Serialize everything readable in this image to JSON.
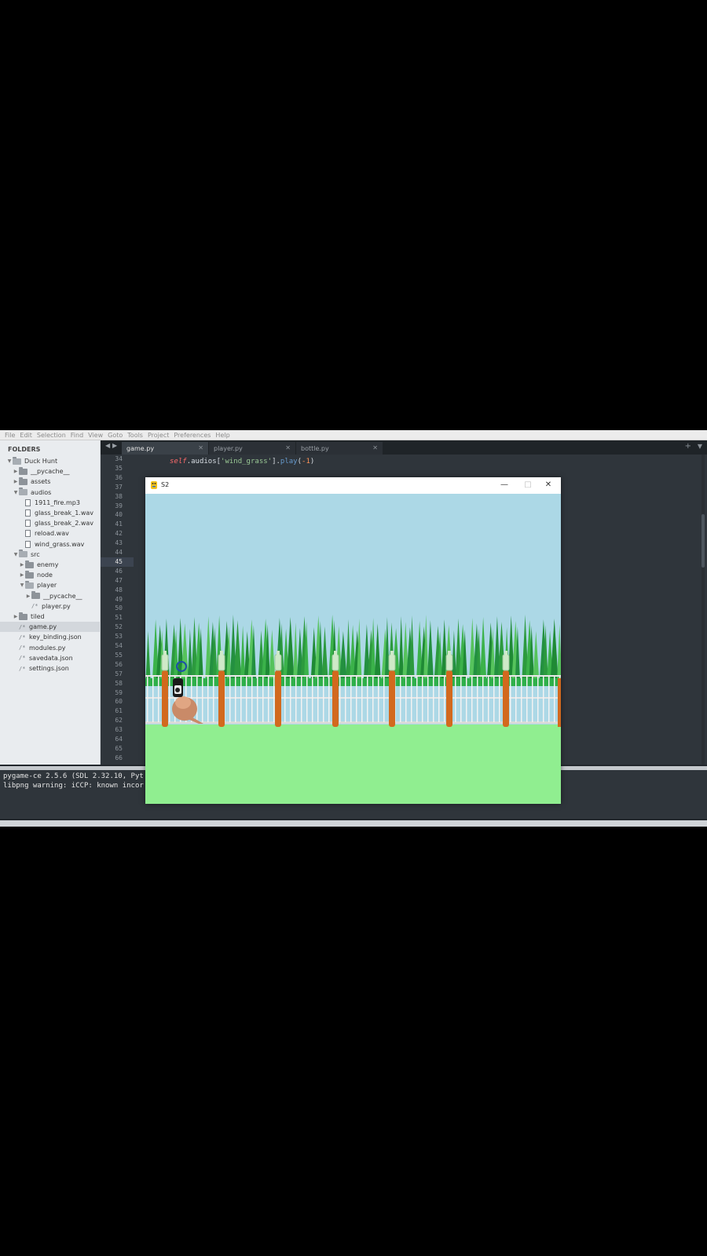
{
  "menu": [
    "File",
    "Edit",
    "Selection",
    "Find",
    "View",
    "Goto",
    "Tools",
    "Project",
    "Preferences",
    "Help"
  ],
  "sidebar": {
    "header": "FOLDERS",
    "items": [
      {
        "label": "Duck Hunt",
        "type": "folder-open",
        "depth": 0
      },
      {
        "label": "__pycache__",
        "type": "folder",
        "depth": 1
      },
      {
        "label": "assets",
        "type": "folder",
        "depth": 1
      },
      {
        "label": "audios",
        "type": "folder-open",
        "depth": 1
      },
      {
        "label": "1911_fire.mp3",
        "type": "file",
        "depth": 2
      },
      {
        "label": "glass_break_1.wav",
        "type": "file",
        "depth": 2
      },
      {
        "label": "glass_break_2.wav",
        "type": "file",
        "depth": 2
      },
      {
        "label": "reload.wav",
        "type": "file",
        "depth": 2
      },
      {
        "label": "wind_grass.wav",
        "type": "file",
        "depth": 2
      },
      {
        "label": "src",
        "type": "folder-open",
        "depth": 1
      },
      {
        "label": "enemy",
        "type": "folder",
        "depth": 2
      },
      {
        "label": "node",
        "type": "folder",
        "depth": 2
      },
      {
        "label": "player",
        "type": "folder-open",
        "depth": 2
      },
      {
        "label": "__pycache__",
        "type": "folder",
        "depth": 3
      },
      {
        "label": "player.py",
        "type": "code",
        "depth": 3
      },
      {
        "label": "tiled",
        "type": "folder",
        "depth": 1
      },
      {
        "label": "game.py",
        "type": "code",
        "depth": 1,
        "selected": true
      },
      {
        "label": "key_binding.json",
        "type": "code",
        "depth": 1
      },
      {
        "label": "modules.py",
        "type": "code",
        "depth": 1
      },
      {
        "label": "savedata.json",
        "type": "code",
        "depth": 1
      },
      {
        "label": "settings.json",
        "type": "code",
        "depth": 1
      }
    ]
  },
  "tabs": [
    {
      "label": "game.py",
      "active": true
    },
    {
      "label": "player.py",
      "active": false
    },
    {
      "label": "bottle.py",
      "active": false
    }
  ],
  "editor": {
    "line_numbers": [
      "34",
      "35",
      "36",
      "37",
      "38",
      "39",
      "40",
      "41",
      "42",
      "43",
      "44",
      "45",
      "46",
      "47",
      "48",
      "49",
      "50",
      "51",
      "52",
      "53",
      "54",
      "55",
      "56",
      "57",
      "58",
      "59",
      "60",
      "61",
      "62",
      "63",
      "64",
      "65",
      "66"
    ],
    "current_line": "45",
    "code": {
      "self_kw": "self",
      "attr": ".audios[",
      "string": "'wind_grass'",
      "close": "].",
      "method": "play",
      "open_paren": "(",
      "number": "-1",
      "close_paren": ")"
    }
  },
  "console": {
    "lines": [
      "pygame-ce 2.5.6 (SDL 2.32.10, Pyt",
      "libpng warning: iCCP: known incor"
    ]
  },
  "game_window": {
    "title": "S2",
    "buttons": {
      "minimize": "—",
      "maximize": "□",
      "close": "✕"
    },
    "colors": {
      "sky": "#acd8e6",
      "grass": "#90ee90",
      "post": "#d2691e",
      "reeds": "#1fa23a",
      "crosshair": "#1e4fa8"
    }
  }
}
